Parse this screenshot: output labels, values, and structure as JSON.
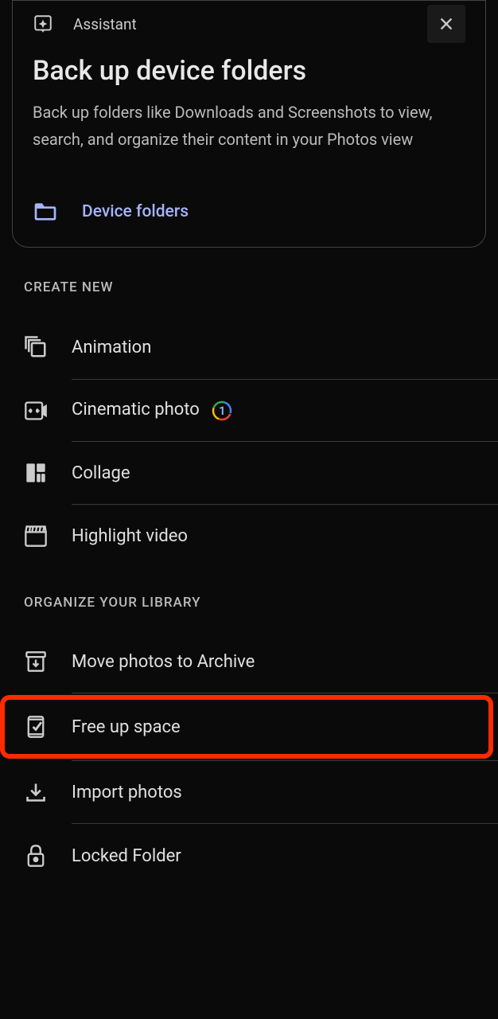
{
  "card": {
    "assistant_label": "Assistant",
    "title": "Back up device folders",
    "description": "Back up folders like Downloads and Screenshots to view, search, and organize their content in your Photos view",
    "action_label": "Device folders"
  },
  "sections": {
    "create_new": {
      "header": "CREATE NEW",
      "items": {
        "animation": "Animation",
        "cinematic": "Cinematic photo",
        "collage": "Collage",
        "highlight_video": "Highlight video"
      }
    },
    "organize": {
      "header": "ORGANIZE YOUR LIBRARY",
      "items": {
        "archive": "Move photos to Archive",
        "free_up": "Free up space",
        "import": "Import photos",
        "locked": "Locked Folder"
      }
    }
  },
  "badge": {
    "one": "1"
  }
}
